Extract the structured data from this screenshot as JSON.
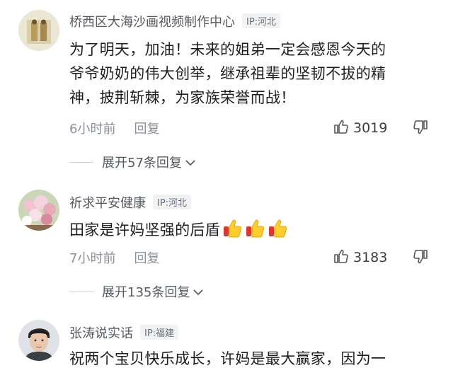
{
  "comments": [
    {
      "username": "桥西区大海沙画视频制作中心",
      "ip": "IP:河北",
      "avatar_icon": "avatar-couple-photo",
      "content_lines": [
        "为了明天，加油！未来的姐弟一定会感恩今天的",
        "爷爷奶奶的伟大创举，继承祖辈的坚韧不拔的精",
        "神，披荆斩棘，为家族荣誉而战！"
      ],
      "time": "6小时前",
      "reply_label": "回复",
      "likes": "3019",
      "expand_label": "展开57条回复"
    },
    {
      "username": "祈求平安健康",
      "ip": "IP:河北",
      "avatar_icon": "avatar-flowers-photo",
      "content_lines": [
        "田家是许妈坚强的后盾"
      ],
      "emoji_count": 3,
      "time": "7小时前",
      "reply_label": "回复",
      "likes": "3183",
      "expand_label": "展开135条回复"
    },
    {
      "username": "张涛说实话",
      "ip": "IP:福建",
      "avatar_icon": "avatar-man-photo",
      "content_lines": [
        "祝两个宝贝快乐成长，许妈是最大赢家，因为一"
      ]
    }
  ],
  "colors": {
    "username": "#555a63",
    "meta": "#8b9099",
    "content": "#1e1e1e",
    "ip_badge_bg": "#f1f2f4"
  }
}
